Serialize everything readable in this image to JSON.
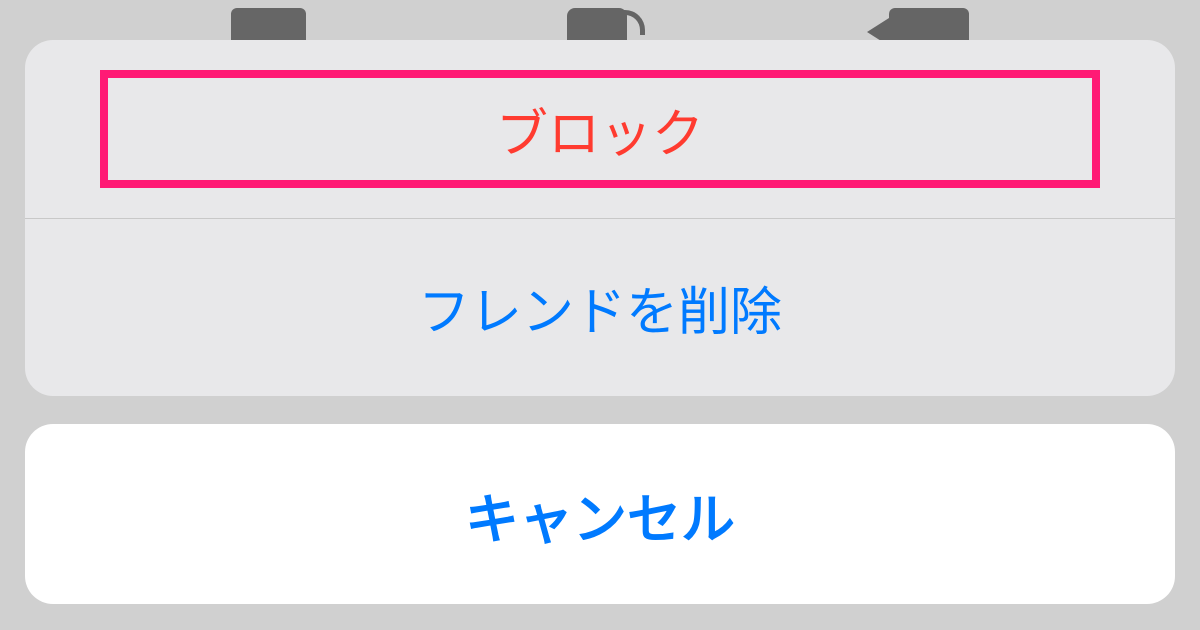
{
  "actionSheet": {
    "block": "ブロック",
    "deleteFriend": "フレンドを削除",
    "cancel": "キャンセル"
  },
  "icons": {
    "chat": "chat-icon",
    "phone": "phone-icon",
    "video": "video-icon"
  },
  "colors": {
    "destructive": "#ff3b30",
    "default": "#007aff",
    "highlight": "#ff1a75"
  }
}
